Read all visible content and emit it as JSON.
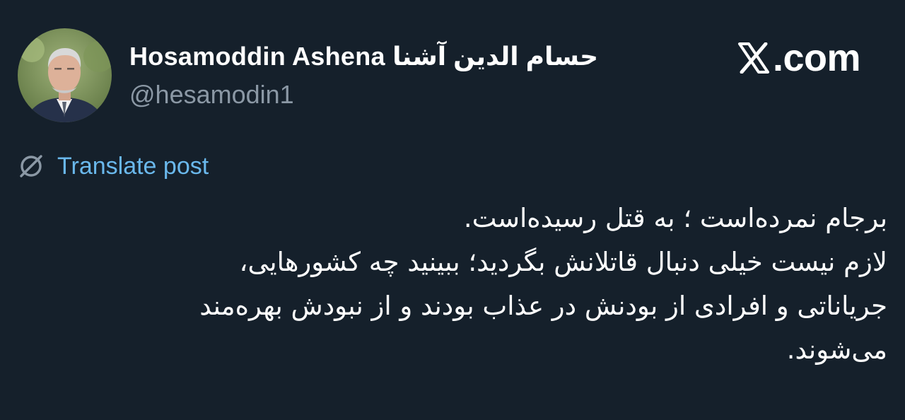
{
  "author": {
    "display_name": "Hosamoddin Ashena حسام الدین آشنا",
    "handle": "@hesamodin1",
    "avatar_icon": "profile-photo"
  },
  "brand": {
    "icon": "x-logo-icon",
    "text": ".com"
  },
  "translate": {
    "icon": "globe-slash-icon",
    "label": "Translate post",
    "color": "#6ab8ec"
  },
  "tweet": {
    "lines": [
      "برجام نمرده‌است ؛ به قتل رسیده‌است.",
      "لازم نیست خیلی دنبال قاتلانش بگردید؛ ببینید چه کشورهایی،",
      "جریاناتی و افرادی از بودنش در عذاب بودند و از نبودش بهره‌مند",
      "می‌شوند."
    ]
  },
  "colors": {
    "background": "#15202b",
    "text": "#ffffff",
    "secondary_text": "#8b98a5",
    "link": "#6ab8ec"
  }
}
